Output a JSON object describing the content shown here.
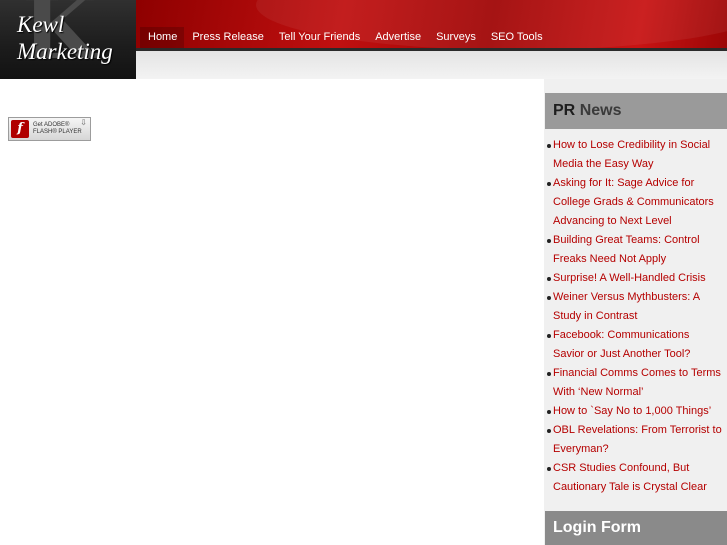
{
  "logo": {
    "line1": "Kewl",
    "line2": "Marketing",
    "monogram": "K"
  },
  "nav": {
    "items": [
      {
        "label": "Home"
      },
      {
        "label": "Press Release"
      },
      {
        "label": "Tell Your Friends"
      },
      {
        "label": "Advertise"
      },
      {
        "label": "Surveys"
      },
      {
        "label": "SEO Tools"
      }
    ]
  },
  "flash": {
    "icon": "flash-icon",
    "line1": "Get ADOBE®",
    "line2": "FLASH® PLAYER",
    "download_icon": "download-arrow-icon"
  },
  "sidebar": {
    "pr_news": {
      "word1": "PR",
      "word2": "News"
    },
    "news_items": [
      {
        "title": "How to Lose Credibility in Social Media the Easy Way"
      },
      {
        "title": "Asking for It: Sage Advice for College Grads & Communicators Advancing to Next Level"
      },
      {
        "title": "Building Great Teams: Control Freaks Need Not Apply"
      },
      {
        "title": "Surprise! A Well-Handled Crisis"
      },
      {
        "title": "Weiner Versus Mythbusters: A Study in Contrast"
      },
      {
        "title": "Facebook: Communications Savior or Just Another Tool?"
      },
      {
        "title": "Financial Comms Comes to Terms With ‘New Normal’"
      },
      {
        "title": "How to `Say No to 1,000 Things’"
      },
      {
        "title": "OBL Revelations: From Terrorist to Everyman?"
      },
      {
        "title": "CSR Studies Confound, But Cautionary Tale is Crystal Clear"
      }
    ],
    "login": {
      "word1": "Login",
      "word2": "Form"
    }
  },
  "colors": {
    "header_red": "#b00c0c",
    "link_red": "#b50000",
    "sidebar_bg": "#f0f0f0",
    "sidebar_head": "#9a9a9a"
  }
}
